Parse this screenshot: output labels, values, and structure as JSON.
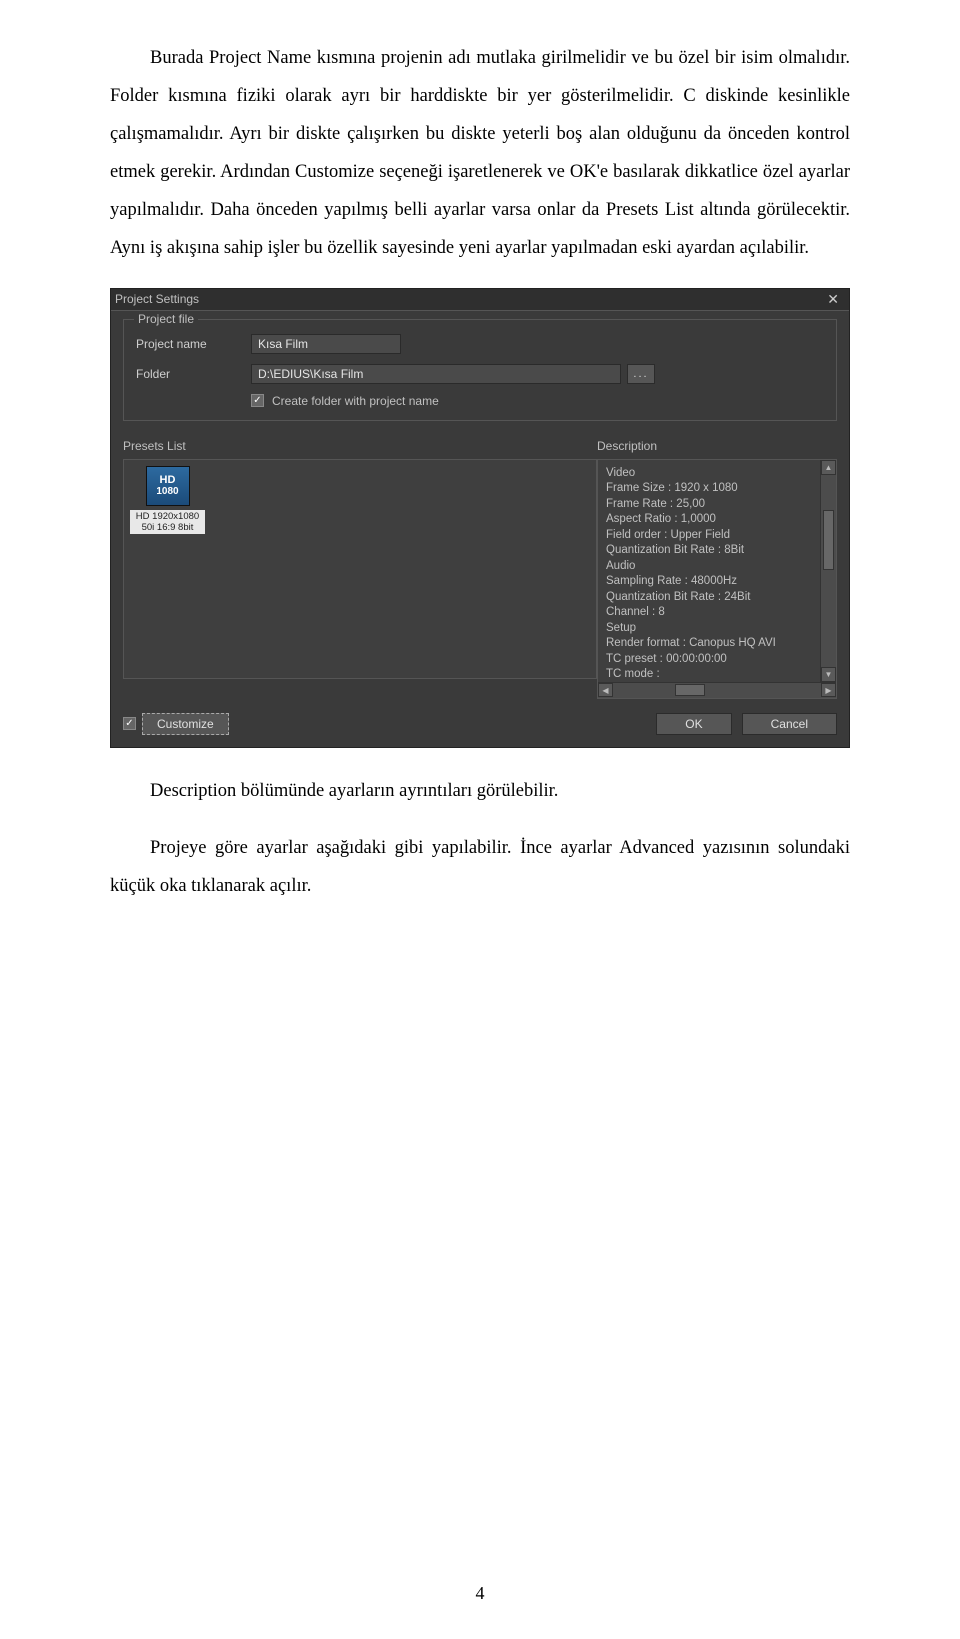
{
  "paragraphs": {
    "p1": "Burada Project Name kısmına projenin adı mutlaka girilmelidir ve bu özel bir isim olmalıdır. Folder kısmına fiziki olarak ayrı bir harddiskte bir yer gösterilmelidir. C diskinde kesinlikle çalışmamalıdır. Ayrı bir diskte çalışırken bu diskte yeterli boş alan olduğunu da önceden kontrol etmek gerekir. Ardından Customize seçeneği işaretlenerek ve OK'e basılarak dikkatlice özel ayarlar yapılmalıdır. Daha önceden yapılmış belli ayarlar varsa onlar da Presets List altında görülecektir. Aynı iş akışına sahip işler bu özellik sayesinde yeni ayarlar yapılmadan eski ayardan açılabilir.",
    "p2": "Description bölümünde ayarların ayrıntıları görülebilir.",
    "p3": "Projeye göre ayarlar aşağıdaki gibi yapılabilir. İnce ayarlar Advanced yazısının solundaki küçük oka tıklanarak açılır."
  },
  "dialog": {
    "title": "Project Settings",
    "project_file_legend": "Project file",
    "project_name_label": "Project name",
    "project_name_value": "Kısa Film",
    "folder_label": "Folder",
    "folder_value": "D:\\EDIUS\\Kısa Film",
    "browse_label": "...",
    "checkbox_label": "Create folder with project name",
    "presets_title": "Presets List",
    "desc_title": "Description",
    "preset_icon_line1": "HD",
    "preset_icon_line2": "1080",
    "preset_label_line1": "HD 1920x1080",
    "preset_label_line2": "50i 16:9 8bit",
    "desc_text": "Video\n Frame Size : 1920 x 1080\n Frame Rate : 25,00\n Aspect Ratio : 1,0000\n Field order : Upper Field\n Quantization Bit Rate : 8Bit\nAudio\n Sampling Rate : 48000Hz\n Quantization Bit Rate : 24Bit\n Channel : 8\nSetup\n Render format : Canopus HQ AVI\n TC preset : 00:00:00:00\n TC mode :\n Total length : --:--:--:--",
    "customize_label": "Customize",
    "ok_label": "OK",
    "cancel_label": "Cancel"
  },
  "page_number": "4"
}
